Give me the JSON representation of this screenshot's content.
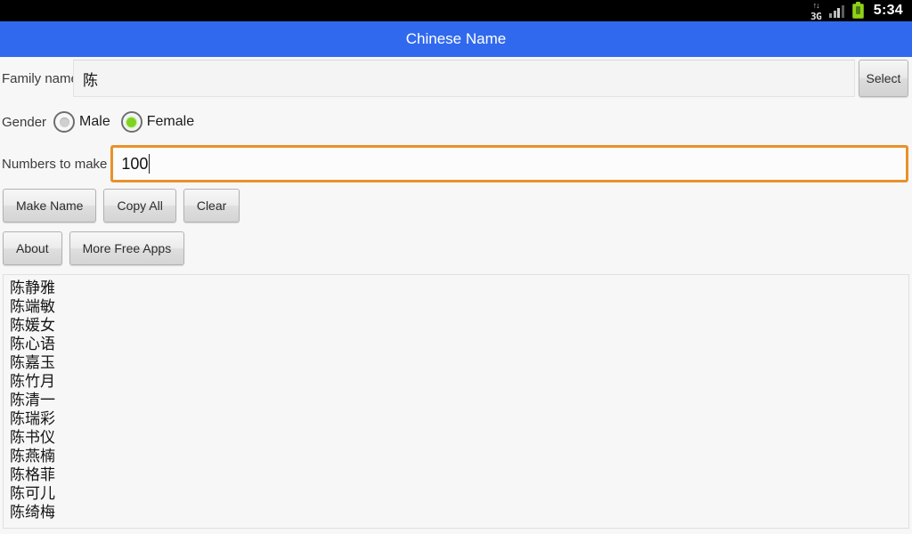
{
  "status_bar": {
    "network_label": "3G",
    "arrows_glyph": "↑↓",
    "time": "5:34",
    "icons": [
      "data-arrows-icon",
      "network-3g-icon",
      "signal-bars-icon",
      "battery-icon"
    ]
  },
  "title_bar": {
    "title": "Chinese Name",
    "background_color": "#3169ee",
    "text_color": "#ffffff"
  },
  "form": {
    "family_name": {
      "label": "Family name",
      "value": "陈",
      "placeholder": ""
    },
    "select_button": {
      "label": "Select"
    },
    "gender": {
      "label": "Gender",
      "options": [
        {
          "label": "Male",
          "checked": false
        },
        {
          "label": "Female",
          "checked": true
        }
      ],
      "selected": "Female",
      "checked_color": "#7ed321"
    },
    "numbers_to_make": {
      "label": "Numbers to make",
      "value": "100",
      "focused": true,
      "focus_border_color": "#e8922a"
    }
  },
  "actions": {
    "row1": [
      {
        "label": "Make Name"
      },
      {
        "label": "Copy All"
      },
      {
        "label": "Clear"
      }
    ],
    "row2": [
      {
        "label": "About"
      },
      {
        "label": "More Free Apps"
      }
    ]
  },
  "results": {
    "names": [
      "陈静雅",
      "陈端敏",
      "陈媛女",
      "陈心语",
      "陈嘉玉",
      "陈竹月",
      "陈清一",
      "陈瑞彩",
      "陈书仪",
      "陈燕楠",
      "陈格菲",
      "陈可儿",
      "陈绮梅"
    ]
  }
}
